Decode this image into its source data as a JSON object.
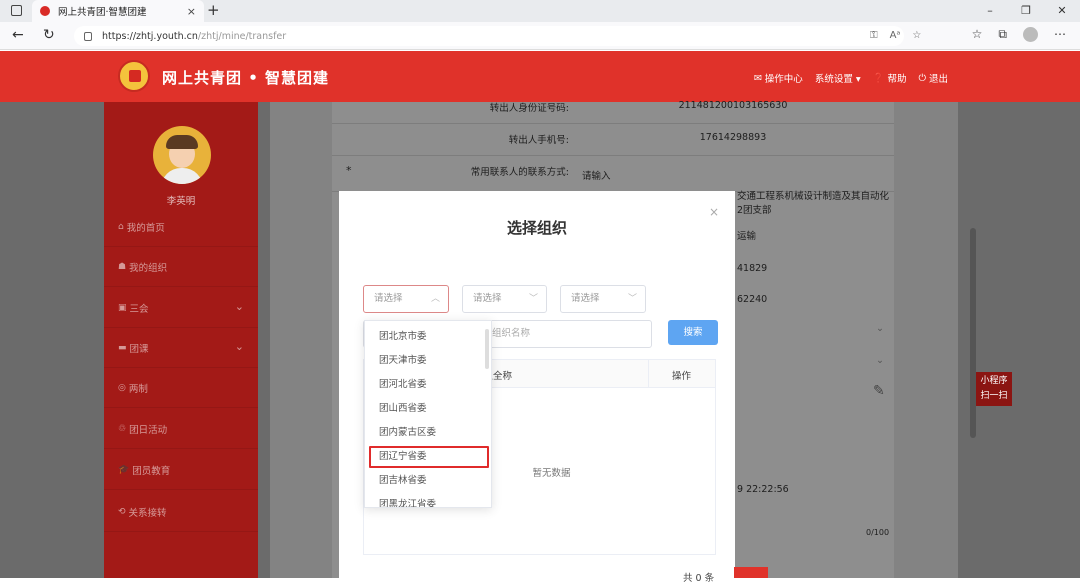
{
  "browser": {
    "tab_title": "网上共青团·智慧团建",
    "tab_close": "×",
    "new_tab": "+",
    "url_host": "https://zhtj.youth.cn",
    "url_path": "/zhtj/mine/transfer",
    "win_minimize": "–",
    "win_restore": "❐",
    "win_close": "✕",
    "nav_back": "←",
    "nav_refresh": "↻",
    "url_icons": [
      "⚿",
      "Aᵃ",
      "☆"
    ],
    "toolbar_icons": [
      "☆",
      "⧉",
      "⋯"
    ]
  },
  "header": {
    "site_title": "网上共青团 • 智慧团建",
    "nav": [
      {
        "icon": "✉",
        "label": "操作中心"
      },
      {
        "icon": "",
        "label": "系统设置 ▾"
      },
      {
        "icon": "❓",
        "label": "帮助"
      },
      {
        "icon": "⏻",
        "label": "退出"
      }
    ]
  },
  "sidebar": {
    "username": "李英明",
    "items": [
      {
        "icon": "⌂",
        "label": "我的首页"
      },
      {
        "icon": "☗",
        "label": "我的组织"
      },
      {
        "icon": "▣",
        "label": "三会",
        "chevron": "⌄"
      },
      {
        "icon": "▬",
        "label": "团课",
        "chevron": "⌄"
      },
      {
        "icon": "◎",
        "label": "两制"
      },
      {
        "icon": "♲",
        "label": "团日活动"
      },
      {
        "icon": "🎓",
        "label": "团员教育"
      },
      {
        "icon": "⟲",
        "label": "关系接转"
      }
    ]
  },
  "form": {
    "rows": [
      {
        "label": "转出人身份证号码:",
        "value": "211481200103165630"
      },
      {
        "label": "转出人手机号:",
        "value": "17614298893"
      },
      {
        "label": "常用联系人的联系方式:",
        "value": "请输入",
        "required": "*"
      }
    ],
    "bg_fragments": [
      "交通工程系机械设计制造及其自动化",
      "2团支部",
      "运输",
      "41829",
      "62240",
      "9 22:22:56",
      "0/100"
    ]
  },
  "qr_badge": {
    "line1": "小程序",
    "line2": "扫一扫"
  },
  "modal": {
    "title": "选择组织",
    "close": "×",
    "select_placeholders": [
      "请选择",
      "请选择",
      "请选择"
    ],
    "org_input_placeholder": "组织名称",
    "search_label": "搜索",
    "table_col_name": "组织全称",
    "table_col_op": "操作",
    "empty_text": "暂无数据",
    "footer_text": "共 0 条"
  },
  "dropdown": {
    "options": [
      "团北京市委",
      "团天津市委",
      "团河北省委",
      "团山西省委",
      "团内蒙古区委",
      "团辽宁省委",
      "团吉林省委",
      "团黑龙江省委"
    ],
    "highlighted_index": 5
  }
}
